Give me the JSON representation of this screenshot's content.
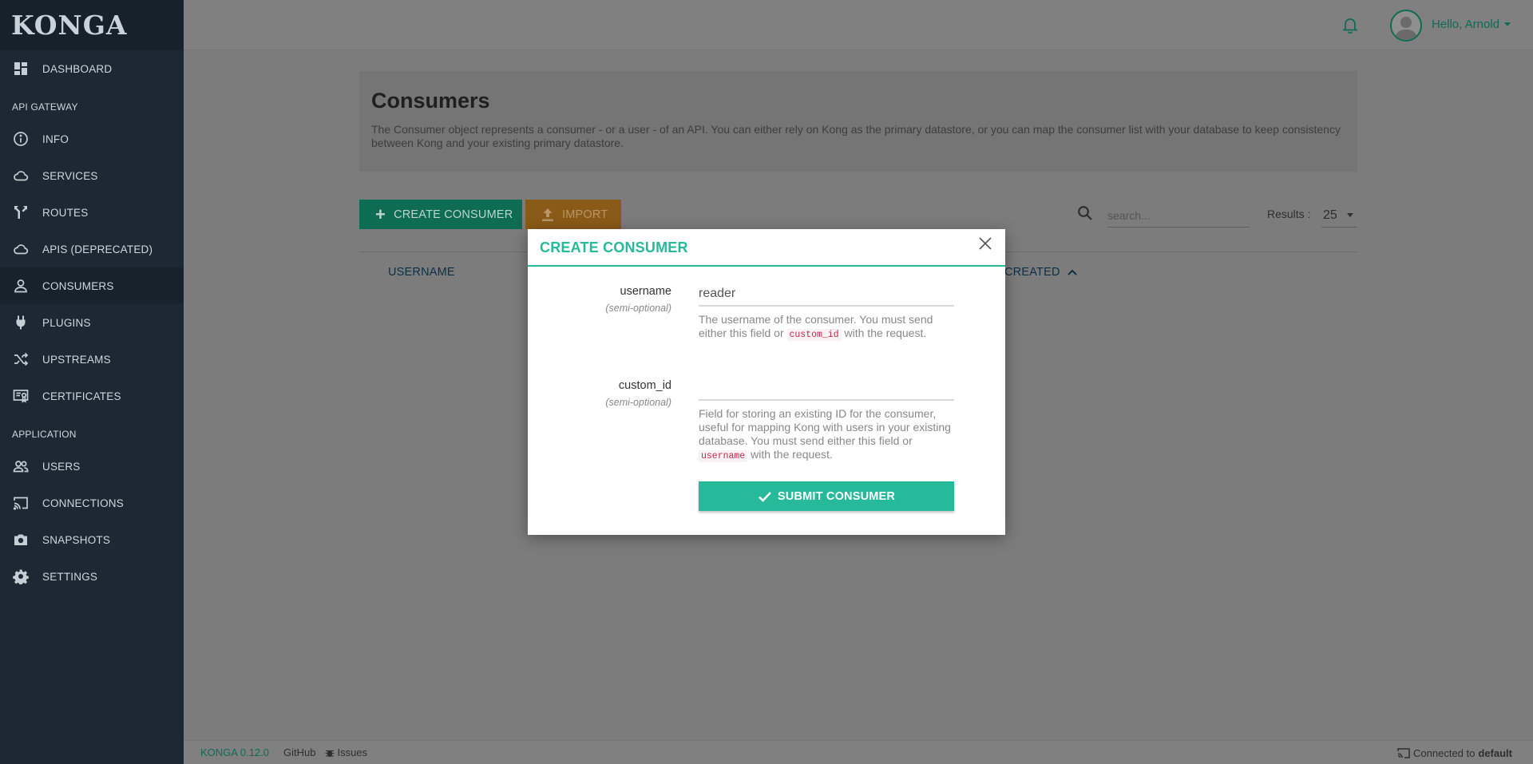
{
  "app": {
    "logo": "KONGA"
  },
  "sidebar": {
    "top_items": [
      {
        "label": "DASHBOARD",
        "icon": "dashboard-icon"
      }
    ],
    "api_gateway_title": "API GATEWAY",
    "api_gateway_items": [
      {
        "label": "INFO",
        "icon": "info-icon"
      },
      {
        "label": "SERVICES",
        "icon": "cloud-icon"
      },
      {
        "label": "ROUTES",
        "icon": "routes-icon"
      },
      {
        "label": "APIS (DEPRECATED)",
        "icon": "cloud-icon"
      },
      {
        "label": "CONSUMERS",
        "icon": "user-icon",
        "active": true
      },
      {
        "label": "PLUGINS",
        "icon": "plug-icon"
      },
      {
        "label": "UPSTREAMS",
        "icon": "shuffle-icon"
      },
      {
        "label": "CERTIFICATES",
        "icon": "certificate-icon"
      }
    ],
    "application_title": "APPLICATION",
    "application_items": [
      {
        "label": "USERS",
        "icon": "users-icon"
      },
      {
        "label": "CONNECTIONS",
        "icon": "cast-icon"
      },
      {
        "label": "SNAPSHOTS",
        "icon": "camera-icon"
      },
      {
        "label": "SETTINGS",
        "icon": "gear-icon"
      }
    ]
  },
  "topbar": {
    "greeting": "Hello, Arnold"
  },
  "page": {
    "title": "Consumers",
    "description": "The Consumer object represents a consumer - or a user - of an API. You can either rely on Kong as the primary datastore, or you can map the consumer list with your database to keep consistency between Kong and your existing primary datastore.",
    "create_button": "CREATE CONSUMER",
    "import_button": "IMPORT",
    "search_placeholder": "search...",
    "results_label": "Results :",
    "results_value": "25",
    "columns": {
      "username": "USERNAME",
      "created": "CREATED"
    }
  },
  "modal": {
    "title": "CREATE CONSUMER",
    "username_label": "username",
    "username_sub": "(semi-optional)",
    "username_value": "reader",
    "username_help_1": "The username of the consumer. You must send either this field or ",
    "username_help_code": "custom_id",
    "username_help_2": " with the request.",
    "customid_label": "custom_id",
    "customid_sub": "(semi-optional)",
    "customid_value": "",
    "customid_help_1": "Field for storing an existing ID for the consumer, useful for mapping Kong with users in your existing database. You must send either this field or ",
    "customid_help_code": "username",
    "customid_help_2": " with the request.",
    "submit_button": "SUBMIT CONSUMER"
  },
  "footer": {
    "version": "KONGA 0.12.0",
    "github": "GitHub",
    "issues": "Issues",
    "connected_prefix": "Connected to",
    "connection_name": "default"
  },
  "colors": {
    "accent": "#26b99a",
    "sidebar_bg": "#1c2833",
    "import_orange": "#e89b2a"
  }
}
